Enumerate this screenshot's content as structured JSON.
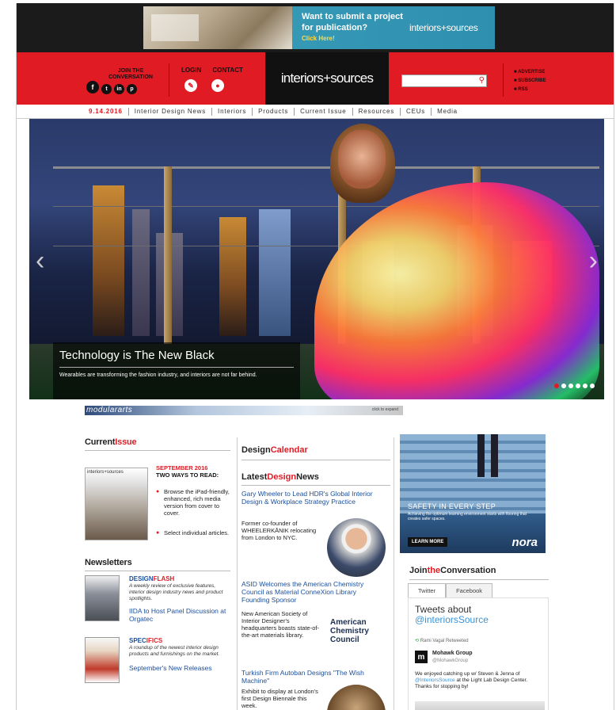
{
  "ad": {
    "headline": "Want to submit a project for publication?",
    "cta": "Click Here!",
    "brand": "interiors+sources"
  },
  "header": {
    "join_label": "JOIN THE CONVERSATION",
    "social": [
      "f",
      "t",
      "in",
      "p"
    ],
    "login": "LOGIN",
    "contact": "CONTACT",
    "logo": "interiors+sources",
    "search_placeholder": "",
    "right_links": [
      "ADVERTISE",
      "SUBSCRIBE",
      "RSS"
    ]
  },
  "nav": [
    "9.14.2016",
    "Interior Design News",
    "Interiors",
    "Products",
    "Current Issue",
    "Resources",
    "CEUs",
    "Media"
  ],
  "hero": {
    "title": "Technology is The New Black",
    "subtitle": "Wearables are transforming the fashion industry, and interiors are not far behind.",
    "slides": 6,
    "active_slide": 0
  },
  "strip": {
    "label": "modulararts",
    "right": "click to expand"
  },
  "current_issue": {
    "title_a": "Current",
    "title_b": "Issue",
    "mag_logo": "interiors+sources",
    "head_red": "SEPTEMBER 2016",
    "head_black": "TWO WAYS TO READ:",
    "li1": "Browse the iPad-friendly, enhanced, rich media version from cover to cover.",
    "li2": "Select individual articles."
  },
  "design_calendar": {
    "title_a": "Design",
    "title_b": "Calendar"
  },
  "latest_news": {
    "title_a": "Latest",
    "title_b": "Design",
    "title_c": "News",
    "items": [
      {
        "title": "Gary Wheeler to Lead HDR's Global Interior Design & Workplace Strategy Practice",
        "desc": "Former co-founder of WHEELERKĀNIK relocating from London to NYC."
      },
      {
        "title": "ASID Welcomes the American Chemistry Council as Material ConneXion Library Founding Sponsor",
        "desc": "New American Society of Interior Designer's headquarters boasts state-of-the-art materials library.",
        "logo": "American Chemistry Council"
      },
      {
        "title": "Turkish Firm Autoban Designs \"The Wish Machine\"",
        "desc": "Exhibit to display at London's first Design Biennale this week."
      }
    ]
  },
  "newsletters": {
    "title": "Newsletters",
    "items": [
      {
        "name_a": "DESIGN",
        "name_b": "FLASH",
        "desc": "A weekly review of exclusive features, interior design industry news and product spotlights.",
        "link": "IIDA to Host Panel Discussion at Orgatec"
      },
      {
        "name_a": "SPEC",
        "name_b": "IFICS",
        "desc": "A roundup of the newest interior design products and furnishings on the market.",
        "link": "September's New Releases"
      }
    ]
  },
  "side_ad": {
    "headline": "SAFETY IN EVERY STEP",
    "sub": "Achieving the optimum learning environment starts with flooring that creates safer spaces.",
    "cta": "LEARN MORE",
    "brand": "nora"
  },
  "join": {
    "title_a": "Join",
    "title_b": "the",
    "title_c": "Conversation",
    "tabs": [
      "Twitter",
      "Facebook"
    ],
    "tweets_head": "Tweets about",
    "handle": "@interiorsSource",
    "retweet": "Rami Vagal Retweeted",
    "account": "Mohawk Group",
    "account_user": "@MohawkGroup",
    "tweet_a": "We enjoyed catching up w/ Steven & Jenna of ",
    "tweet_mention": "@InteriorsSource",
    "tweet_b": " at the Light Lab Design Center. Thanks for stopping by!"
  }
}
